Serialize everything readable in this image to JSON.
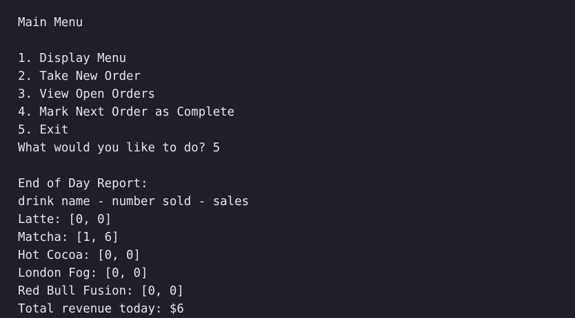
{
  "menu": {
    "title": "Main Menu",
    "options": [
      "1. Display Menu",
      "2. Take New Order",
      "3. View Open Orders",
      "4. Mark Next Order as Complete",
      "5. Exit"
    ],
    "prompt": "What would you like to do? ",
    "answer": "5"
  },
  "report": {
    "title": "End of Day Report:",
    "header": "drink name - number sold - sales",
    "rows": [
      "Latte: [0, 0]",
      "Matcha: [1, 6]",
      "Hot Cocoa: [0, 0]",
      "London Fog: [0, 0]",
      "Red Bull Fusion: [0, 0]"
    ],
    "total": "Total revenue today: $6"
  }
}
